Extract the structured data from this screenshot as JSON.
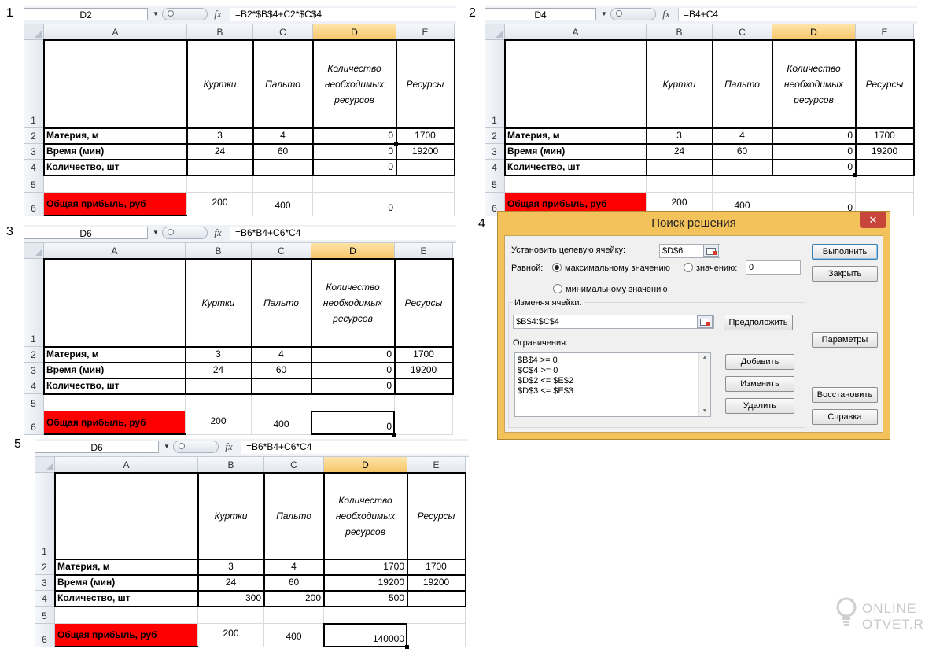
{
  "steps": [
    "1",
    "2",
    "3",
    "4",
    "5"
  ],
  "sheets": [
    {
      "namebox": "D2",
      "formula": "=B2*$B$4+C2*$C$4",
      "cols": [
        "A",
        "B",
        "C",
        "D",
        "E"
      ],
      "sel_col": 3,
      "rows": [
        "1",
        "2",
        "3",
        "4",
        "5",
        "6"
      ],
      "cells": {
        "A2": "Материя, м",
        "A3": "Время (мин)",
        "A4": "Количество, шт",
        "A6": "Общая прибыль,  руб",
        "B1": "Куртки",
        "C1": "Пальто",
        "D1": "Количество необходимых ресурсов",
        "E1": "Ресурсы",
        "B2": "3",
        "C2": "4",
        "D2": "0",
        "E2": "1700",
        "B3": "24",
        "C3": "60",
        "D3": "0",
        "E3": "19200",
        "B4": "",
        "C4": "",
        "D4": "0",
        "B6": "200",
        "C6": "400",
        "D6": "0"
      },
      "selected": "D2"
    },
    {
      "namebox": "D4",
      "formula": "=B4+C4",
      "cols": [
        "A",
        "B",
        "C",
        "D",
        "E"
      ],
      "sel_col": 3,
      "rows": [
        "1",
        "2",
        "3",
        "4",
        "5",
        "6"
      ],
      "cells": {
        "A2": "Материя, м",
        "A3": "Время (мин)",
        "A4": "Количество, шт",
        "A6": "Общая прибыль,  руб",
        "B1": "Куртки",
        "C1": "Пальто",
        "D1": "Количество необходимых ресурсов",
        "E1": "Ресурсы",
        "B2": "3",
        "C2": "4",
        "D2": "0",
        "E2": "1700",
        "B3": "24",
        "C3": "60",
        "D3": "0",
        "E3": "19200",
        "B4": "",
        "C4": "",
        "D4": "0",
        "B6": "200",
        "C6": "400",
        "D6": "0"
      },
      "selected": "D4"
    },
    {
      "namebox": "D6",
      "formula": "=B6*B4+C6*C4",
      "cols": [
        "A",
        "B",
        "C",
        "D",
        "E"
      ],
      "sel_col": 3,
      "rows": [
        "1",
        "2",
        "3",
        "4",
        "5",
        "6"
      ],
      "cells": {
        "A2": "Материя, м",
        "A3": "Время (мин)",
        "A4": "Количество, шт",
        "A6": "Общая прибыль,  руб",
        "B1": "Куртки",
        "C1": "Пальто",
        "D1": "Количество необходимых ресурсов",
        "E1": "Ресурсы",
        "B2": "3",
        "C2": "4",
        "D2": "0",
        "E2": "1700",
        "B3": "24",
        "C3": "60",
        "D3": "0",
        "E3": "19200",
        "B4": "",
        "C4": "",
        "D4": "0",
        "B6": "200",
        "C6": "400",
        "D6": "0"
      },
      "selected": "D6"
    },
    {
      "namebox": "D6",
      "formula": "=B6*B4+C6*C4",
      "cols": [
        "A",
        "B",
        "C",
        "D",
        "E"
      ],
      "sel_col": 3,
      "rows": [
        "1",
        "2",
        "3",
        "4",
        "5",
        "6"
      ],
      "cells": {
        "A2": "Материя, м",
        "A3": "Время (мин)",
        "A4": "Количество, шт",
        "A6": "Общая прибыль,  руб",
        "B1": "Куртки",
        "C1": "Пальто",
        "D1": "Количество необходимых ресурсов",
        "E1": "Ресурсы",
        "B2": "3",
        "C2": "4",
        "D2": "1700",
        "E2": "1700",
        "B3": "24",
        "C3": "60",
        "D3": "19200",
        "E3": "19200",
        "B4": "300",
        "C4": "200",
        "D4": "500",
        "B6": "200",
        "C6": "400",
        "D6": "140000"
      },
      "selected": "D6"
    }
  ],
  "dialog": {
    "title": "Поиск решения",
    "close": "✕",
    "target_label": "Установить целевую ячейку:",
    "target_value": "$D$6",
    "equal_label": "Равной:",
    "opt_max": "максимальному значению",
    "opt_value": "значению:",
    "value_field": "0",
    "opt_min": "минимальному значению",
    "changing_label": "Изменяя ячейки:",
    "changing_value": "$B$4:$C$4",
    "guess_btn": "Предположить",
    "constraints_label": "Ограничения:",
    "constraints": [
      "$B$4 >= 0",
      "$C$4 >= 0",
      "$D$2 <= $E$2",
      "$D$3 <= $E$3"
    ],
    "add_btn": "Добавить",
    "change_btn": "Изменить",
    "delete_btn": "Удалить",
    "solve_btn": "Выполнить",
    "close_btn": "Закрыть",
    "params_btn": "Параметры",
    "reset_btn": "Восстановить",
    "help_btn": "Справка",
    "selected_option": "max"
  },
  "watermark": {
    "line1": "ONLINE",
    "line2": "OTVET.RU"
  }
}
